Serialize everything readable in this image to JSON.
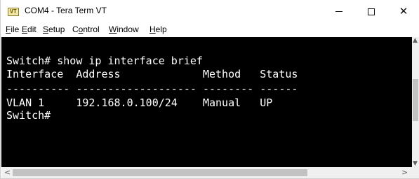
{
  "window": {
    "title": "COM4 - Tera Term VT",
    "icon_text": "VT"
  },
  "menu": [
    {
      "label_ul": "F",
      "label_rest": "ile"
    },
    {
      "label_ul": "E",
      "label_rest": "dit"
    },
    {
      "label_ul": "S",
      "label_rest": "etup",
      "prefix": ""
    },
    {
      "label_pre": "C",
      "label_ul": "o",
      "label_rest": "ntrol"
    },
    {
      "label_ul": "W",
      "label_rest": "indow"
    },
    {
      "label_ul": "H",
      "label_rest": "elp"
    }
  ],
  "terminal": {
    "lines": [
      "",
      "Switch# show ip interface brief",
      "Interface  Address             Method   Status",
      "---------- ------------------- -------- ------",
      "VLAN 1     192.168.0.100/24    Manual   UP",
      "Switch#"
    ],
    "colors": {
      "background": "#000000",
      "foreground": "#ffffff"
    }
  },
  "icons": {
    "minimize": "minimize-icon",
    "maximize": "maximize-icon",
    "close": "close-icon"
  }
}
